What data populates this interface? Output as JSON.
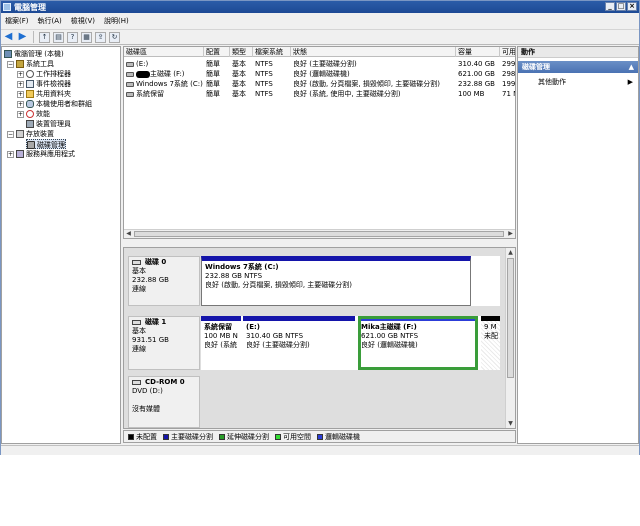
{
  "window": {
    "title": "電腦管理"
  },
  "menu": [
    "檔案(F)",
    "執行(A)",
    "檢視(V)",
    "說明(H)"
  ],
  "tree": {
    "root": "電腦管理 (本機)",
    "system_tools": "系統工具",
    "task_scheduler": "工作排程器",
    "event_viewer": "事件檢視器",
    "shared_folders": "共用資料夾",
    "local_users": "本機使用者和群組",
    "performance": "效能",
    "device_manager": "裝置管理員",
    "storage": "存放裝置",
    "disk_management": "磁碟管理",
    "services": "服務與應用程式"
  },
  "volume_list": {
    "headers": [
      "磁碟區",
      "配置",
      "類型",
      "檔案系統",
      "狀態",
      "容量",
      "可用"
    ],
    "rows": [
      {
        "name": "(E:)",
        "layout": "簡單",
        "type": "基本",
        "fs": "NTFS",
        "status": "良好 (主要磁碟分割)",
        "capacity": "310.40 GB",
        "free": "299."
      },
      {
        "name": "主磁碟 (F:)",
        "layout": "簡單",
        "type": "基本",
        "fs": "NTFS",
        "status": "良好 (邏輯磁碟機)",
        "capacity": "621.00 GB",
        "free": "298."
      },
      {
        "name": "Windows 7系統 (C:)",
        "layout": "簡單",
        "type": "基本",
        "fs": "NTFS",
        "status": "良好 (啟動, 分頁檔案, 損毀傾印, 主要磁碟分割)",
        "capacity": "232.88 GB",
        "free": "199."
      },
      {
        "name": "系統保留",
        "layout": "簡單",
        "type": "基本",
        "fs": "NTFS",
        "status": "良好 (系統, 使用中, 主要磁碟分割)",
        "capacity": "100 MB",
        "free": "71 M"
      }
    ]
  },
  "disks": {
    "disk0": {
      "name": "磁碟 0",
      "type": "基本",
      "size": "232.88 GB",
      "status": "連線",
      "parts": [
        {
          "name": "Windows 7系統 (C:)",
          "line2": "232.88 GB NTFS",
          "line3": "良好 (啟動, 分頁檔案, 損毀傾印, 主要磁碟分割)"
        }
      ]
    },
    "disk1": {
      "name": "磁碟 1",
      "type": "基本",
      "size": "931.51 GB",
      "status": "連線",
      "parts": [
        {
          "name": "系統保留",
          "line2": "100 MB N",
          "line3": "良好 (系統"
        },
        {
          "name": "(E:)",
          "line2": "310.40 GB NTFS",
          "line3": "良好 (主要磁碟分割)"
        },
        {
          "name": "Mika主磁碟 (F:)",
          "line2": "621.00 GB NTFS",
          "line3": "良好 (邏輯磁碟機)"
        },
        {
          "name": "",
          "line2": "9 M",
          "line3": "未配"
        }
      ]
    },
    "cdrom0": {
      "name": "CD-ROM 0",
      "type": "DVD (D:)",
      "status": "沒有媒體"
    }
  },
  "legend": [
    {
      "label": "未配置",
      "color": "#000000"
    },
    {
      "label": "主要磁碟分割",
      "color": "#1414aa"
    },
    {
      "label": "延伸磁碟分割",
      "color": "#2a9d2a"
    },
    {
      "label": "可用空間",
      "color": "#33dd33"
    },
    {
      "label": "邏輯磁碟機",
      "color": "#2c3dd8"
    }
  ],
  "actions": {
    "header": "動作",
    "section": "磁碟管理",
    "item": "其他動作"
  }
}
